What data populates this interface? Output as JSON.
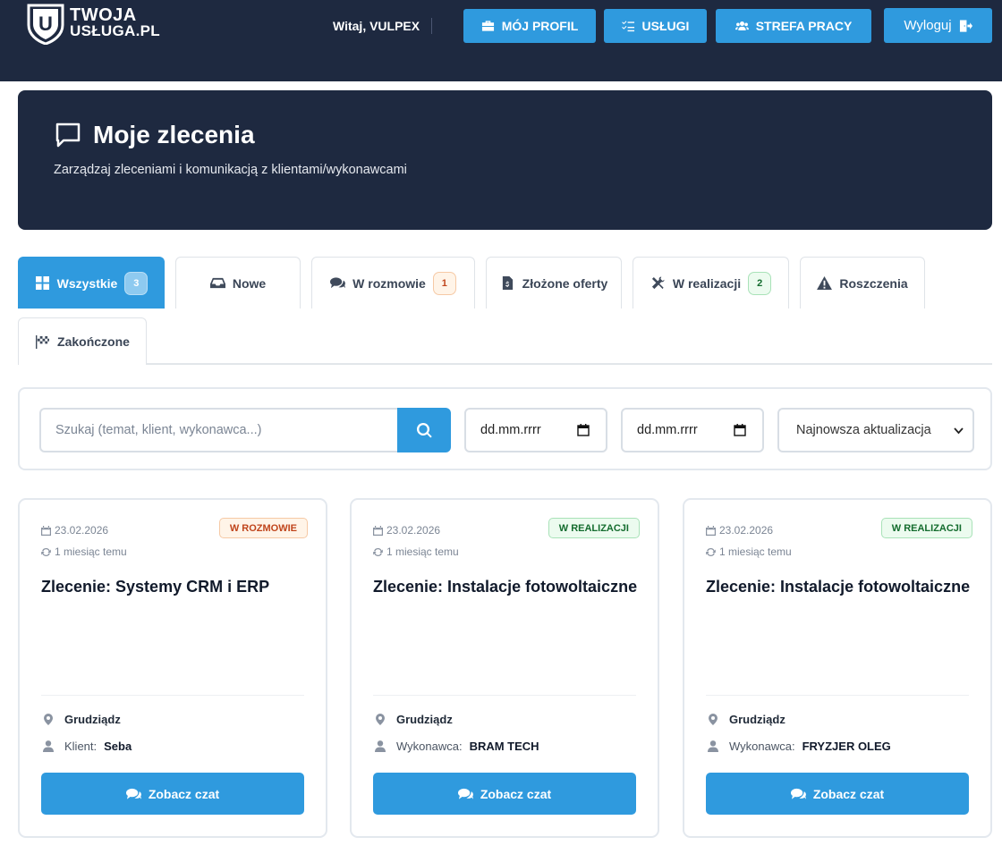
{
  "nav": {
    "logo_line1": "TWOJA",
    "logo_line2": "USŁUGA.PL",
    "logo_letter": "U",
    "welcome": "Witaj, VULPEX",
    "buttons": {
      "profile": "MÓJ PROFIL",
      "services": "USŁUGI",
      "work_zone": "STREFA PRACY",
      "logout": "Wyloguj"
    }
  },
  "hero": {
    "title": "Moje zlecenia",
    "subtitle": "Zarządzaj zleceniami i komunikacją z klientami/wykonawcami"
  },
  "tabs": [
    {
      "label": "Wszystkie",
      "badge": "3",
      "icon": "grid-icon",
      "active": true
    },
    {
      "label": "Nowe",
      "badge": "",
      "icon": "inbox-icon"
    },
    {
      "label": "W rozmowie",
      "badge": "1",
      "icon": "comments-icon"
    },
    {
      "label": "Złożone oferty",
      "badge": "",
      "icon": "invoice-dollar-icon"
    },
    {
      "label": "W realizacji",
      "badge": "2",
      "icon": "tools-icon"
    },
    {
      "label": "Roszczenia",
      "badge": "",
      "icon": "warning-icon"
    },
    {
      "label": "Zakończone",
      "badge": "",
      "icon": "flag-checkered-icon"
    }
  ],
  "filters": {
    "search_placeholder": "Szukaj (temat, klient, wykonawca...)",
    "date_from": "dd.mm.rrrr",
    "date_to": "dd.mm.rrrr",
    "sort": "Najnowsza aktualizacja"
  },
  "cards": [
    {
      "date": "23.02.2026",
      "updated": "1 miesiąc temu",
      "status": "W ROZMOWIE",
      "status_color": "#c0451c",
      "title": "Zlecenie: Systemy CRM i ERP",
      "location": "Grudziądz",
      "person_label": "Klient:",
      "person_name": "Seba",
      "button": "Zobacz czat"
    },
    {
      "date": "23.02.2026",
      "updated": "1 miesiąc temu",
      "status": "W REALIZACJI",
      "status_color": "#146c2e",
      "title": "Zlecenie: Instalacje fotowoltaiczne",
      "location": "Grudziądz",
      "person_label": "Wykonawca:",
      "person_name": "BRAM TECH",
      "button": "Zobacz czat"
    },
    {
      "date": "23.02.2026",
      "updated": "1 miesiąc temu",
      "status": "W REALIZACJI",
      "status_color": "#146c2e",
      "title": "Zlecenie: Instalacje fotowoltaiczne",
      "location": "Grudziądz",
      "person_label": "Wykonawca:",
      "person_name": "FRYZJER OLEG",
      "button": "Zobacz czat"
    }
  ],
  "colors": {
    "navy": "#1e2940",
    "accent": "#2f9ade"
  }
}
